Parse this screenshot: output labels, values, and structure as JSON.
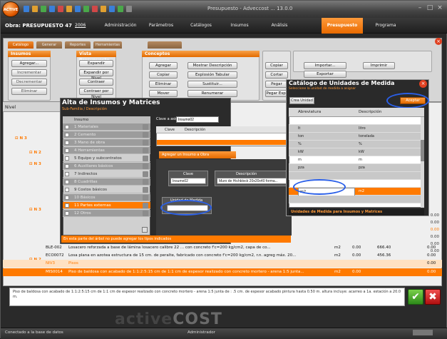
{
  "window": {
    "title": "Presupuesto - Adveccost ... 13.0.0",
    "app_icon_label": "ACTIVE"
  },
  "obra": {
    "label": "Obra: PRESUPUESTO 47",
    "date": "2006"
  },
  "menu_tabs": [
    {
      "label": "Administración"
    },
    {
      "label": "Parámetros"
    },
    {
      "label": "Catálogos"
    },
    {
      "label": "Insumos"
    },
    {
      "label": "Análisis"
    },
    {
      "label": "Presupuesto"
    },
    {
      "label": "Programa"
    }
  ],
  "ribbon": {
    "subtabs": [
      "Catálogo",
      "Generar",
      "Reportes",
      "Herramientas"
    ],
    "groups": {
      "insumos": {
        "title": "Insumos",
        "buttons": [
          "Agregar...",
          "Incrementar",
          "Decrementar",
          "Eliminar"
        ]
      },
      "vista": {
        "title": "Vista Presupuesto",
        "buttons": [
          "Expandir",
          "Expandir por Nivel",
          "Contraer",
          "Contraer por Nivel"
        ]
      },
      "conceptos": {
        "title": "Conceptos",
        "buttons": [
          "Agregar",
          "Copiar",
          "Eliminar",
          "Mover",
          "Mostrar Descripción",
          "Explosión Tabular",
          "Sustituir...",
          "Renumerar"
        ]
      },
      "copiar": {
        "buttons": [
          "Copiar",
          "Cortar",
          "Pegar",
          "Pegar Esp."
        ]
      },
      "importar": {
        "buttons": [
          "Importar...",
          "Exportar",
          "Imprimir"
        ]
      }
    }
  },
  "tree": {
    "column": "Nivel",
    "rows": [
      {
        "code": "BLE-002",
        "desc": "Losacero reforzada a base de lámina losacero calibre 22 ... con concreto f'c=200 kg/cm2, capa de co...",
        "unit": "m2",
        "qty": "0.00",
        "price": "666.40",
        "total": "0.00"
      },
      {
        "code": "ECO0072",
        "desc": "Losa plana en azotea estructura de 15 cm. de peralte, fabricado con concreto f'c=200 kg/cm2, r.n. agreg máx. 20...",
        "unit": "m2",
        "qty": "0.00",
        "price": "456.36",
        "total": "0.00"
      },
      {
        "code": "NIV3",
        "desc": "Pisos",
        "unit": "",
        "qty": "",
        "price": "",
        "total": "0.00"
      },
      {
        "code": "MIS0014",
        "desc": "Piso de baldosa con acabado de 1:1:2:5:15 cm de 1:1 cm de espesor realizado con concreto mortero - arena 1:5 junta...",
        "unit": "m2",
        "qty": "0.00",
        "price": "",
        "total": "0.00"
      }
    ],
    "right_values": [
      "0.00",
      "0.00",
      "0.00",
      "0.00",
      "0.00",
      "0.00",
      "0.00"
    ]
  },
  "alta_dialog": {
    "title": "Alta de Insumos y Matrices",
    "subtitle": "Sub-Familia / Descripción",
    "list_header": "Insumo",
    "list_items": [
      {
        "label": "1 Materiales",
        "state": "gray"
      },
      {
        "label": "2 Cemento",
        "state": "gray"
      },
      {
        "label": "3 Mano de obra",
        "state": "gray"
      },
      {
        "label": "4 Herramientas",
        "state": "gray"
      },
      {
        "label": "5 Equipo y subcontratos",
        "state": "normal"
      },
      {
        "label": "6 Auxiliares básicos",
        "state": "gray"
      },
      {
        "label": "7 Indirectos",
        "state": "normal"
      },
      {
        "label": "8 Cuadrillas",
        "state": "gray"
      },
      {
        "label": "9 Costos básicos",
        "state": "normal"
      },
      {
        "label": "10 Básicos",
        "state": "gray"
      },
      {
        "label": "11 Partes externas",
        "state": "sel"
      },
      {
        "label": "12 Otros",
        "state": "gray"
      }
    ],
    "code_label": "Clave a asignar:",
    "code_value": "Insumo02",
    "grid_headers": [
      "Clave",
      "Descripción"
    ],
    "agregar_label": "Agregar un Insumo a Obra",
    "clave_label": "Clave",
    "clave_value": "Insumo02",
    "descripcion_label": "Descripción",
    "descripcion_value": "Muro de Hichblock 20x20x40 forma...",
    "unidad_label": "Unidad de Medida",
    "unidad_value": "",
    "note": "En esta parte del árbol no puede agregar los tipos indicados"
  },
  "cat_dialog": {
    "title": "Catálogo de Unidades de Medida",
    "subtitle": "Seleccione la unidad de medida a asignar",
    "nueva_label": "Crea Unidad",
    "aceptar_label": "Aceptar",
    "headers": [
      "Abreviatura",
      "Descripción"
    ],
    "rows": [
      {
        "abbr": "",
        "desc": "",
        "state": "normal"
      },
      {
        "abbr": "lt",
        "desc": "litro",
        "state": "alt"
      },
      {
        "abbr": "ton",
        "desc": "tonelada",
        "state": "alt"
      },
      {
        "abbr": "%",
        "desc": "%",
        "state": "alt"
      },
      {
        "abbr": "kW",
        "desc": "kW",
        "state": "alt"
      },
      {
        "abbr": "m",
        "desc": "m",
        "state": "normal"
      },
      {
        "abbr": "pza",
        "desc": "pza",
        "state": "alt"
      },
      {
        "abbr": "m2",
        "desc": "m2",
        "state": "sel"
      },
      {
        "abbr": "",
        "desc": "",
        "state": "alt"
      }
    ],
    "edit_value": "m2",
    "footer": "Unidades de Medida para Insumos y Matrices"
  },
  "description_text": "Piso de baldosa con acabado de 1:1:2:5:15 cm de 1:1 cm de espesor realizado con concreto mortero - arena 1:5 junta de : .5 cm. de espesor acabado pintura hasta 0.50 m. altura incluye: acarreo a 1a. estación a 20.0 m.",
  "logo": {
    "prefix": "active",
    "suffix": "COST"
  },
  "status": {
    "left": "Conectado a la base de datos",
    "middle": "Administrador"
  },
  "colors": {
    "accent": "#ff7a00",
    "highlight": "#2a5fe8"
  }
}
